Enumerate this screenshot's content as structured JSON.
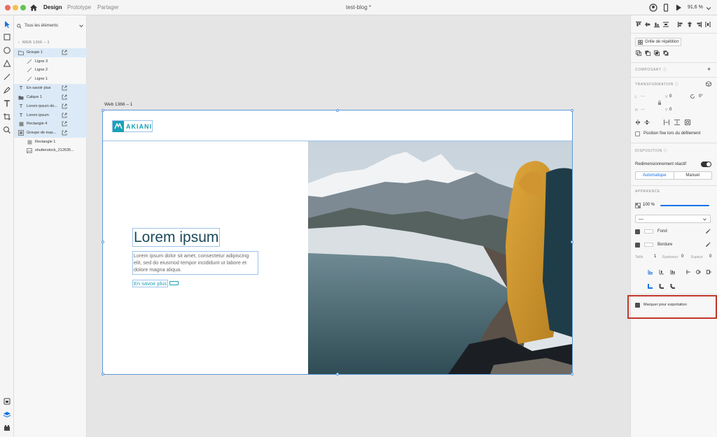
{
  "titlebar": {
    "modes": [
      "Design",
      "Prototype",
      "Partager"
    ],
    "document_title": "test-blog *",
    "zoom": "91,6 %",
    "colors": {
      "close": "#ed6a5e",
      "minimize": "#f5bf4f",
      "maximize": "#61c554"
    }
  },
  "layers": {
    "search_placeholder": "Tous les éléments",
    "breadcrumb": "WEB 1366 – 1",
    "items": [
      {
        "label": "Groupe 1",
        "icon": "folder-icon",
        "selected": true
      },
      {
        "label": "Ligne 3",
        "icon": "line-icon",
        "selected": false
      },
      {
        "label": "Ligne 2",
        "icon": "line-icon",
        "selected": false
      },
      {
        "label": "Ligne 1",
        "icon": "line-icon",
        "selected": false
      },
      {
        "label": "En savoir plus",
        "icon": "text-icon",
        "selected": true
      },
      {
        "label": "Calque 1",
        "icon": "folder-icon",
        "selected": true
      },
      {
        "label": "Lorem ipsum do...",
        "icon": "text-icon",
        "selected": true
      },
      {
        "label": "Lorem ipsum",
        "icon": "text-icon",
        "selected": true
      },
      {
        "label": "Rectangle 4",
        "icon": "rectangle-icon",
        "selected": true
      },
      {
        "label": "Groupe de mas...",
        "icon": "mask-group-icon",
        "selected": true
      },
      {
        "label": "Rectangle 1",
        "icon": "rectangle-icon",
        "selected": false
      },
      {
        "label": "shutterstock_212635...",
        "icon": "image-icon",
        "selected": false
      }
    ]
  },
  "canvas": {
    "artboard_label": "Web 1366 – 1",
    "logo_text": "AKIANI",
    "hero_title": "Lorem ipsum",
    "hero_text": "Lorem ipsum dolor sit amet, consectetur adipiscing elit, sed do eiusmod tempor incididunt ut labore et dolore magna aliqua.",
    "cta": "En savoir plus",
    "brand_color": "#1aa1b5"
  },
  "properties": {
    "repeat_grid": "Grille de répétition",
    "component": "COMPOSANT",
    "transform": "TRANSFORMATION",
    "l_label": "L",
    "l_value": "—",
    "x_label": "X",
    "x_value": "0",
    "rotation": "0°",
    "h_label": "H",
    "h_value": "—",
    "y_label": "Y",
    "y_value": "0",
    "fixed_position": "Position fixe lors du défilement",
    "layout": "DISPOSITION",
    "responsive_resize": "Redimensionnement réactif",
    "auto": "Automatique",
    "manual": "Manuel",
    "appearance": "APPARENCE",
    "opacity": "100 %",
    "blend": "—",
    "fill": "Fond",
    "border": "Bordure",
    "size_label": "Taille",
    "size_value": "1",
    "thickness_label": "Épaisseur",
    "thickness_value": "0",
    "gap_label": "Espace",
    "gap_value": "0",
    "export_mark": "Marquer pour exportation",
    "accent_color": "#1473e6",
    "highlight_color": "#c0392b"
  }
}
